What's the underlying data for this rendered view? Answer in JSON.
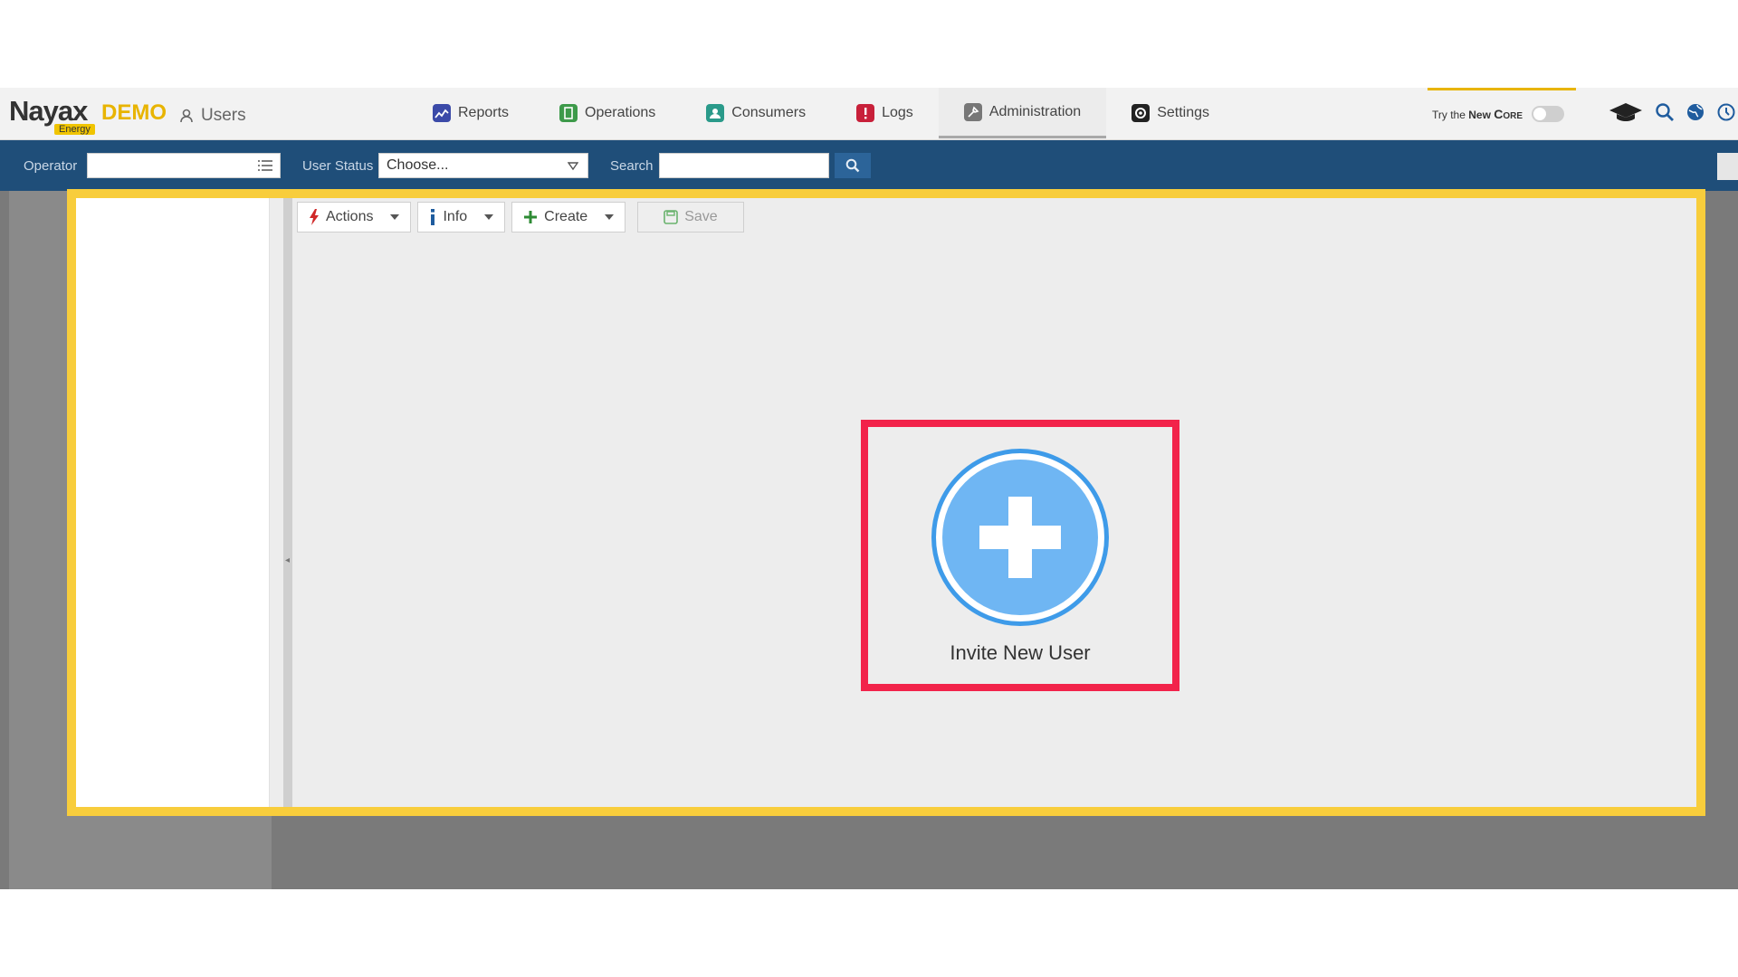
{
  "header": {
    "logo_main": "Nayax",
    "logo_demo": "DEMO",
    "logo_sub": "Energy",
    "page_title": "Users",
    "nav": [
      {
        "label": "Reports",
        "icon": "reports-icon",
        "color": "#3b4aa8"
      },
      {
        "label": "Operations",
        "icon": "operations-icon",
        "color": "#3d9a4a"
      },
      {
        "label": "Consumers",
        "icon": "consumers-icon",
        "color": "#2a9a8a"
      },
      {
        "label": "Logs",
        "icon": "logs-icon",
        "color": "#c8203a"
      },
      {
        "label": "Administration",
        "icon": "administration-icon",
        "color": "#777777"
      },
      {
        "label": "Settings",
        "icon": "settings-icon",
        "color": "#222222"
      }
    ],
    "try_prefix": "Try the",
    "try_new": "New",
    "try_core": "Core"
  },
  "filters": {
    "operator_label": "Operator",
    "user_status_label": "User Status",
    "user_status_value": "Choose...",
    "search_label": "Search"
  },
  "toolbar": {
    "actions_label": "Actions",
    "info_label": "Info",
    "create_label": "Create",
    "save_label": "Save"
  },
  "invite": {
    "label": "Invite New User"
  },
  "colors": {
    "highlight_yellow": "#f8cd3c",
    "highlight_red": "#f2234a",
    "filterbar": "#1f4e79",
    "invite_blue": "#3e9be9"
  }
}
